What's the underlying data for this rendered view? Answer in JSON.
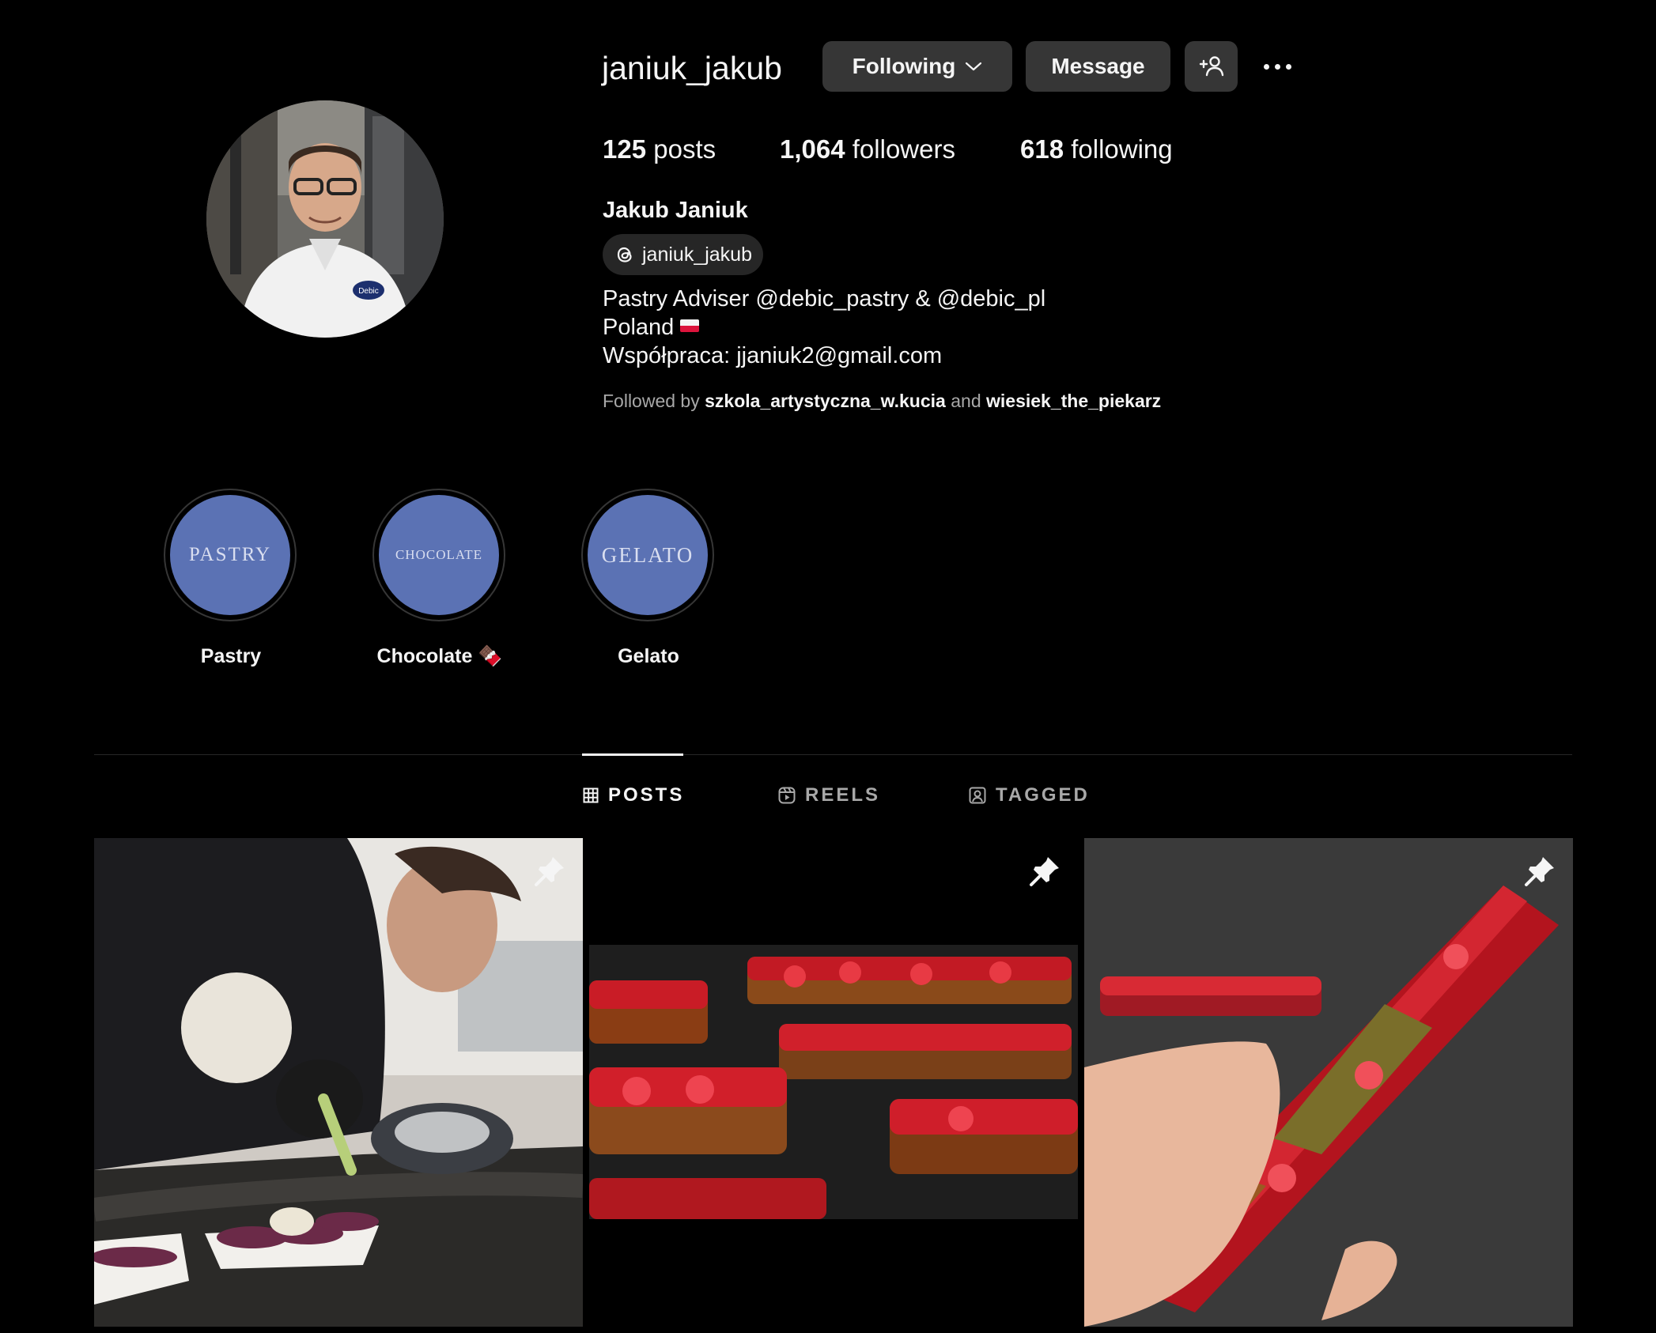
{
  "profile": {
    "username": "janiuk_jakub",
    "full_name": "Jakub Janiuk",
    "threads_handle": "janiuk_jakub",
    "bio": {
      "line1": "Pastry Adviser @debic_pastry & @debic_pl",
      "line2": "Poland",
      "line3": "Współpraca: jjaniuk2@gmail.com"
    },
    "followed_by": {
      "prefix": "Followed by",
      "user1": "szkola_artystyczna_w.kucia",
      "conj": "and",
      "user2": "wiesiek_the_piekarz"
    }
  },
  "actions": {
    "following_label": "Following",
    "message_label": "Message"
  },
  "stats": {
    "posts_count": "125",
    "posts_label": "posts",
    "followers_count": "1,064",
    "followers_label": "followers",
    "following_count": "618",
    "following_label": "following"
  },
  "highlights": [
    {
      "cover_text": "PASTRY",
      "label": "Pastry"
    },
    {
      "cover_text": "CHOCOLATE",
      "label": "Chocolate 🍫"
    },
    {
      "cover_text": "GELATO",
      "label": "Gelato"
    }
  ],
  "tabs": {
    "posts": "POSTS",
    "reels": "REELS",
    "tagged": "TAGGED"
  },
  "colors": {
    "background": "#000000",
    "button": "#363636",
    "highlight_cover": "#5b72b4",
    "muted_text": "#a8a8a8"
  },
  "icons": {
    "following_chevron": "chevron-down-icon",
    "add_user": "add-user-icon",
    "more": "more-options-icon",
    "threads": "threads-icon",
    "posts_tab": "grid-icon",
    "reels_tab": "reels-icon",
    "tagged_tab": "tagged-icon",
    "pinned": "pin-icon"
  }
}
